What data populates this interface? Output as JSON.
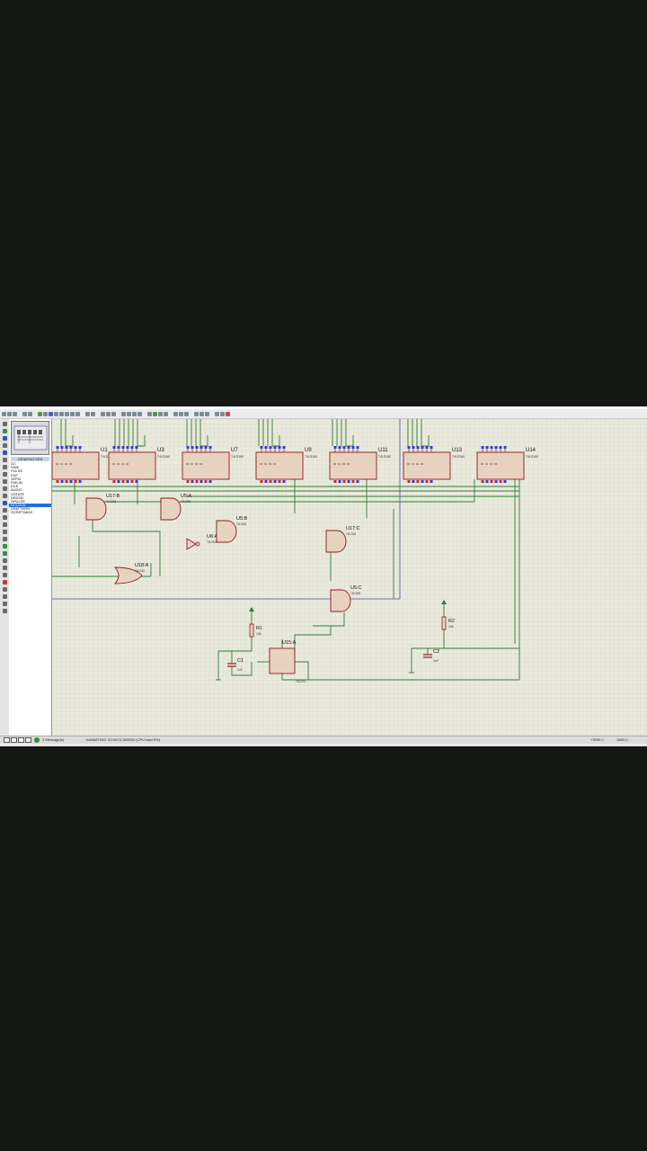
{
  "app": {
    "window_title": ""
  },
  "panel": {
    "title": "GENERATORS",
    "items": [
      "DC",
      "SINE",
      "PULSE",
      "EXP",
      "SFFM",
      "PWLIN",
      "FILE",
      "AUDIO",
      "DSTATE",
      "DEDGE",
      "DPULSE",
      "DCLOCK",
      "DPATTERN",
      "SCRIPTABLE"
    ],
    "selected_index": 11
  },
  "components": {
    "counters": [
      {
        "ref": "U1",
        "part": "74LS160"
      },
      {
        "ref": "U3",
        "part": "74LS160"
      },
      {
        "ref": "U7",
        "part": "74LS160"
      },
      {
        "ref": "U9",
        "part": "74LS160"
      },
      {
        "ref": "U11",
        "part": "74LS160"
      },
      {
        "ref": "U13",
        "part": "74LS160"
      },
      {
        "ref": "U14",
        "part": "74LS160"
      }
    ],
    "gates": [
      {
        "ref": "U17:B",
        "part": "74LS08"
      },
      {
        "ref": "U5:A",
        "part": "74LS08"
      },
      {
        "ref": "U6:A",
        "part": "74LS04"
      },
      {
        "ref": "U5:B",
        "part": "74LS08"
      },
      {
        "ref": "U17:C",
        "part": "74LS08"
      },
      {
        "ref": "U18:A",
        "part": "74LS32"
      },
      {
        "ref": "U5:C",
        "part": "74LS08"
      }
    ],
    "timer": {
      "ref": "U15:A",
      "part": "74LS74"
    },
    "resistors": [
      {
        "ref": "R1",
        "value": "10k"
      },
      {
        "ref": "R2",
        "value": "10k"
      }
    ],
    "capacitors": [
      {
        "ref": "C1",
        "value": "1nF"
      },
      {
        "ref": "C2",
        "value": "1nF"
      }
    ]
  },
  "status": {
    "messages": "2 Message(s)",
    "animating": "ANIMATING: 00:04:01.900000 (CPU load 5%)",
    "coord_x": "+3000.0",
    "coord_y": "-3600.0"
  },
  "colors": {
    "wire": "#2e7d32",
    "part_fill": "#e7d2c0",
    "part_outline": "#8b1a1a",
    "grid_bg": "#e9e9dc",
    "sheet_border": "#4a4ab0",
    "selected": "#1f6fd8"
  }
}
